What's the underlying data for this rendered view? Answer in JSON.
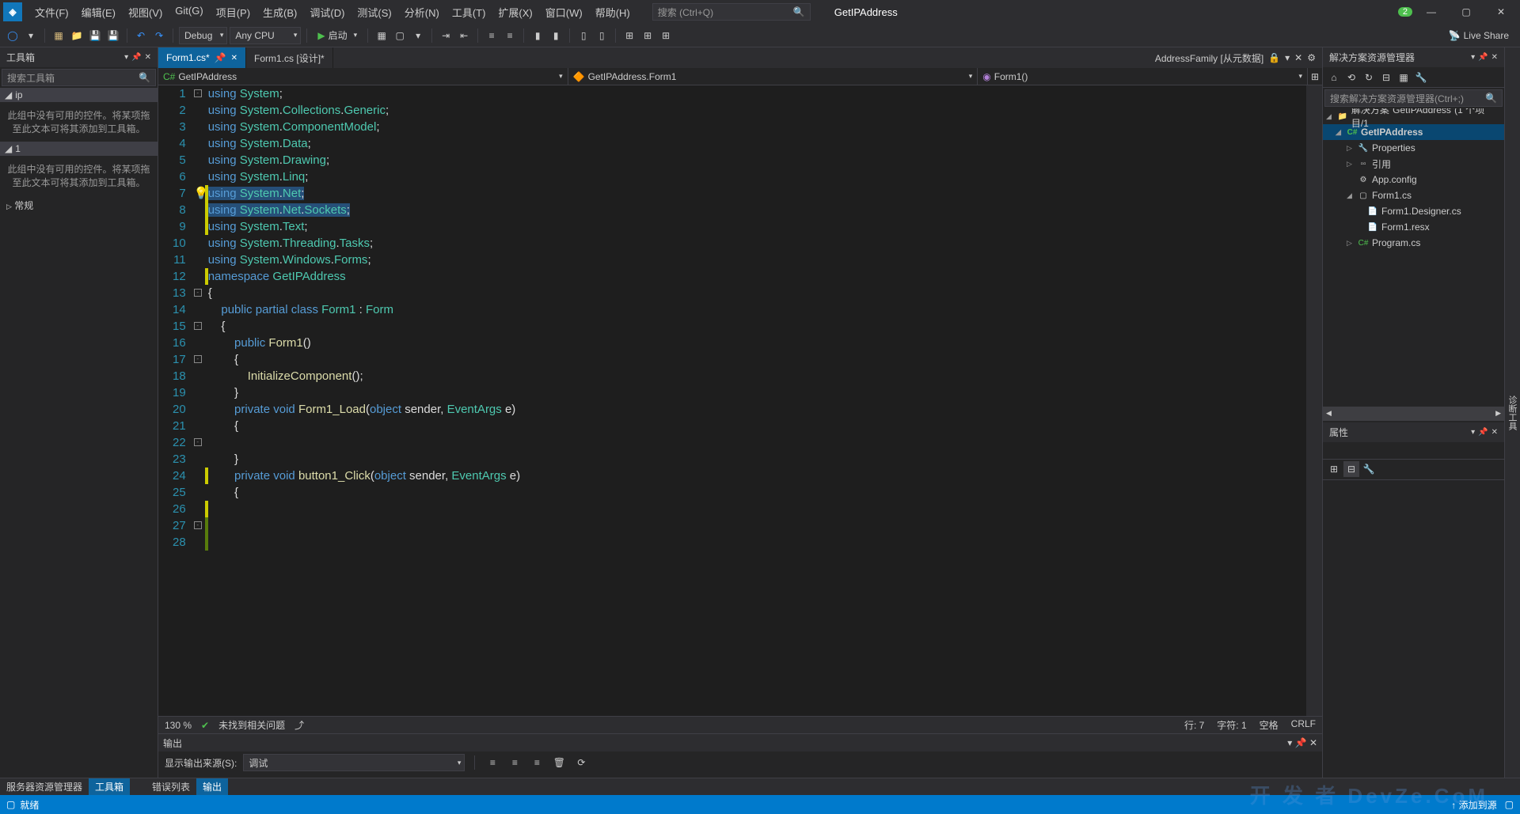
{
  "menus": [
    "文件(F)",
    "编辑(E)",
    "视图(V)",
    "Git(G)",
    "项目(P)",
    "生成(B)",
    "调试(D)",
    "测试(S)",
    "分析(N)",
    "工具(T)",
    "扩展(X)",
    "窗口(W)",
    "帮助(H)"
  ],
  "title_search_placeholder": "搜索 (Ctrl+Q)",
  "app_name": "GetIPAddress",
  "notif_badge": "2",
  "toolbar": {
    "config": "Debug",
    "platform": "Any CPU",
    "start": "启动"
  },
  "live_share": "Live Share",
  "toolbox": {
    "title": "工具箱",
    "search_placeholder": "搜索工具箱",
    "section1": "ip",
    "empty1": "此组中没有可用的控件。将某项拖至此文本可将其添加到工具箱。",
    "section2": "1",
    "empty2": "此组中没有可用的控件。将某项拖至此文本可将其添加到工具箱。",
    "section3": "常规"
  },
  "tabs": {
    "t1": "Form1.cs*",
    "t2": "Form1.cs [设计]*",
    "right_label": "AddressFamily [从元数据]"
  },
  "nav": {
    "n1": "GetIPAddress",
    "n2": "GetIPAddress.Form1",
    "n3": "Form1()"
  },
  "code_lines": [
    {
      "n": 1,
      "tokens": [
        [
          "kw",
          "using"
        ],
        [
          "",
          " "
        ],
        [
          "cls",
          "System"
        ],
        [
          "",
          ";"
        ]
      ],
      "fold": "-"
    },
    {
      "n": 2,
      "tokens": [
        [
          "kw",
          "using"
        ],
        [
          "",
          " "
        ],
        [
          "cls",
          "System"
        ],
        [
          "",
          "."
        ],
        [
          "cls",
          "Collections"
        ],
        [
          "",
          "."
        ],
        [
          "cls",
          "Generic"
        ],
        [
          "",
          ";"
        ]
      ]
    },
    {
      "n": 3,
      "tokens": [
        [
          "kw",
          "using"
        ],
        [
          "",
          " "
        ],
        [
          "cls",
          "System"
        ],
        [
          "",
          "."
        ],
        [
          "cls",
          "ComponentModel"
        ],
        [
          "",
          ";"
        ]
      ]
    },
    {
      "n": 4,
      "tokens": [
        [
          "kw",
          "using"
        ],
        [
          "",
          " "
        ],
        [
          "cls",
          "System"
        ],
        [
          "",
          "."
        ],
        [
          "cls",
          "Data"
        ],
        [
          "",
          ";"
        ]
      ]
    },
    {
      "n": 5,
      "tokens": [
        [
          "kw",
          "using"
        ],
        [
          "",
          " "
        ],
        [
          "cls",
          "System"
        ],
        [
          "",
          "."
        ],
        [
          "cls",
          "Drawing"
        ],
        [
          "",
          ";"
        ]
      ]
    },
    {
      "n": 6,
      "tokens": [
        [
          "kw",
          "using"
        ],
        [
          "",
          " "
        ],
        [
          "cls",
          "System"
        ],
        [
          "",
          "."
        ],
        [
          "cls",
          "Linq"
        ],
        [
          "",
          ";"
        ]
      ]
    },
    {
      "n": 7,
      "tokens": [
        [
          "kw hl",
          "using"
        ],
        [
          "hl",
          " "
        ],
        [
          "cls hl",
          "System"
        ],
        [
          "hl",
          "."
        ],
        [
          "cls hl",
          "Net"
        ],
        [
          "hl",
          ";"
        ]
      ],
      "bulb": true,
      "change": "yellow"
    },
    {
      "n": 8,
      "tokens": [
        [
          "kw hl",
          "using"
        ],
        [
          "hl",
          " "
        ],
        [
          "cls hl",
          "System"
        ],
        [
          "hl",
          "."
        ],
        [
          "cls hl",
          "Net"
        ],
        [
          "hl",
          "."
        ],
        [
          "cls hl",
          "Sockets"
        ],
        [
          "hl",
          ";"
        ]
      ],
      "change": "yellow"
    },
    {
      "n": 9,
      "tokens": [
        [
          "kw",
          "using"
        ],
        [
          "",
          " "
        ],
        [
          "cls",
          "System"
        ],
        [
          "",
          "."
        ],
        [
          "cls",
          "Text"
        ],
        [
          "",
          ";"
        ]
      ],
      "change": "yellow"
    },
    {
      "n": 10,
      "tokens": [
        [
          "kw",
          "using"
        ],
        [
          "",
          " "
        ],
        [
          "cls",
          "System"
        ],
        [
          "",
          "."
        ],
        [
          "cls",
          "Threading"
        ],
        [
          "",
          "."
        ],
        [
          "cls",
          "Tasks"
        ],
        [
          "",
          ";"
        ]
      ]
    },
    {
      "n": 11,
      "tokens": [
        [
          "kw",
          "using"
        ],
        [
          "",
          " "
        ],
        [
          "cls",
          "System"
        ],
        [
          "",
          "."
        ],
        [
          "cls",
          "Windows"
        ],
        [
          "",
          "."
        ],
        [
          "cls",
          "Forms"
        ],
        [
          "",
          ";"
        ]
      ]
    },
    {
      "n": 12,
      "tokens": [
        [
          "",
          ""
        ]
      ],
      "change": "yellow"
    },
    {
      "n": 13,
      "tokens": [
        [
          "kw",
          "namespace"
        ],
        [
          "",
          " "
        ],
        [
          "cls",
          "GetIPAddress"
        ]
      ],
      "fold": "-"
    },
    {
      "n": 14,
      "tokens": [
        [
          "",
          "{"
        ]
      ]
    },
    {
      "n": 15,
      "indent": 4,
      "tokens": [
        [
          "kw",
          "public"
        ],
        [
          "",
          " "
        ],
        [
          "kw",
          "partial"
        ],
        [
          "",
          " "
        ],
        [
          "kw",
          "class"
        ],
        [
          "",
          " "
        ],
        [
          "cls",
          "Form1"
        ],
        [
          "",
          " : "
        ],
        [
          "cls",
          "Form"
        ]
      ],
      "fold": "-"
    },
    {
      "n": 16,
      "indent": 4,
      "tokens": [
        [
          "",
          "{"
        ]
      ]
    },
    {
      "n": 17,
      "indent": 8,
      "tokens": [
        [
          "kw",
          "public"
        ],
        [
          "",
          " "
        ],
        [
          "mtd",
          "Form1"
        ],
        [
          "",
          "()"
        ]
      ],
      "fold": "-"
    },
    {
      "n": 18,
      "indent": 8,
      "tokens": [
        [
          "",
          "{"
        ]
      ]
    },
    {
      "n": 19,
      "indent": 12,
      "tokens": [
        [
          "mtd",
          "InitializeComponent"
        ],
        [
          "",
          "();"
        ]
      ]
    },
    {
      "n": 20,
      "indent": 8,
      "tokens": [
        [
          "",
          "}"
        ]
      ]
    },
    {
      "n": 21,
      "tokens": [
        [
          "",
          ""
        ]
      ]
    },
    {
      "n": 22,
      "indent": 8,
      "tokens": [
        [
          "kw",
          "private"
        ],
        [
          "",
          " "
        ],
        [
          "kw",
          "void"
        ],
        [
          "",
          " "
        ],
        [
          "mtd",
          "Form1_Load"
        ],
        [
          "",
          "("
        ],
        [
          "kw",
          "object"
        ],
        [
          "",
          " sender, "
        ],
        [
          "cls",
          "EventArgs"
        ],
        [
          "",
          " e)"
        ]
      ],
      "fold": "-"
    },
    {
      "n": 23,
      "indent": 8,
      "tokens": [
        [
          "",
          "{"
        ]
      ]
    },
    {
      "n": 24,
      "indent": 8,
      "tokens": [
        [
          "",
          ""
        ]
      ],
      "change": "yellow"
    },
    {
      "n": 25,
      "indent": 8,
      "tokens": [
        [
          "",
          "}"
        ]
      ]
    },
    {
      "n": 26,
      "tokens": [
        [
          "",
          ""
        ]
      ],
      "change": "yellow"
    },
    {
      "n": 27,
      "indent": 8,
      "tokens": [
        [
          "kw",
          "private"
        ],
        [
          "",
          " "
        ],
        [
          "kw",
          "void"
        ],
        [
          "",
          " "
        ],
        [
          "mtd",
          "button1_Click"
        ],
        [
          "",
          "("
        ],
        [
          "kw",
          "object"
        ],
        [
          "",
          " sender, "
        ],
        [
          "cls",
          "EventArgs"
        ],
        [
          "",
          " e)"
        ]
      ],
      "fold": "-",
      "change": "green"
    },
    {
      "n": 28,
      "indent": 8,
      "tokens": [
        [
          "",
          "{"
        ]
      ],
      "change": "green"
    }
  ],
  "editor_status": {
    "zoom": "130 %",
    "issues": "未找到相关问题",
    "line": "行: 7",
    "col": "字符: 1",
    "ins": "空格",
    "enc": "CRLF"
  },
  "output": {
    "title": "输出",
    "source_label": "显示输出来源(S):",
    "source_value": "调试"
  },
  "bottom_tabs_left": [
    "服务器资源管理器",
    "工具箱"
  ],
  "bottom_tabs_center": [
    "错误列表",
    "输出"
  ],
  "solution": {
    "title": "解决方案资源管理器",
    "search_placeholder": "搜索解决方案资源管理器(Ctrl+;)",
    "root": "解决方案\"GetIPAddress\"(1 个项目/1",
    "project": "GetIPAddress",
    "nodes": [
      "Properties",
      "引用",
      "App.config",
      "Form1.cs",
      "Form1.Designer.cs",
      "Form1.resx",
      "Program.cs"
    ]
  },
  "properties": {
    "title": "属性"
  },
  "side_labels": "诊断工具",
  "status": {
    "ready": "就绪",
    "add": "添加到源"
  },
  "watermark": "开 发 者\nDevZe.CoM"
}
